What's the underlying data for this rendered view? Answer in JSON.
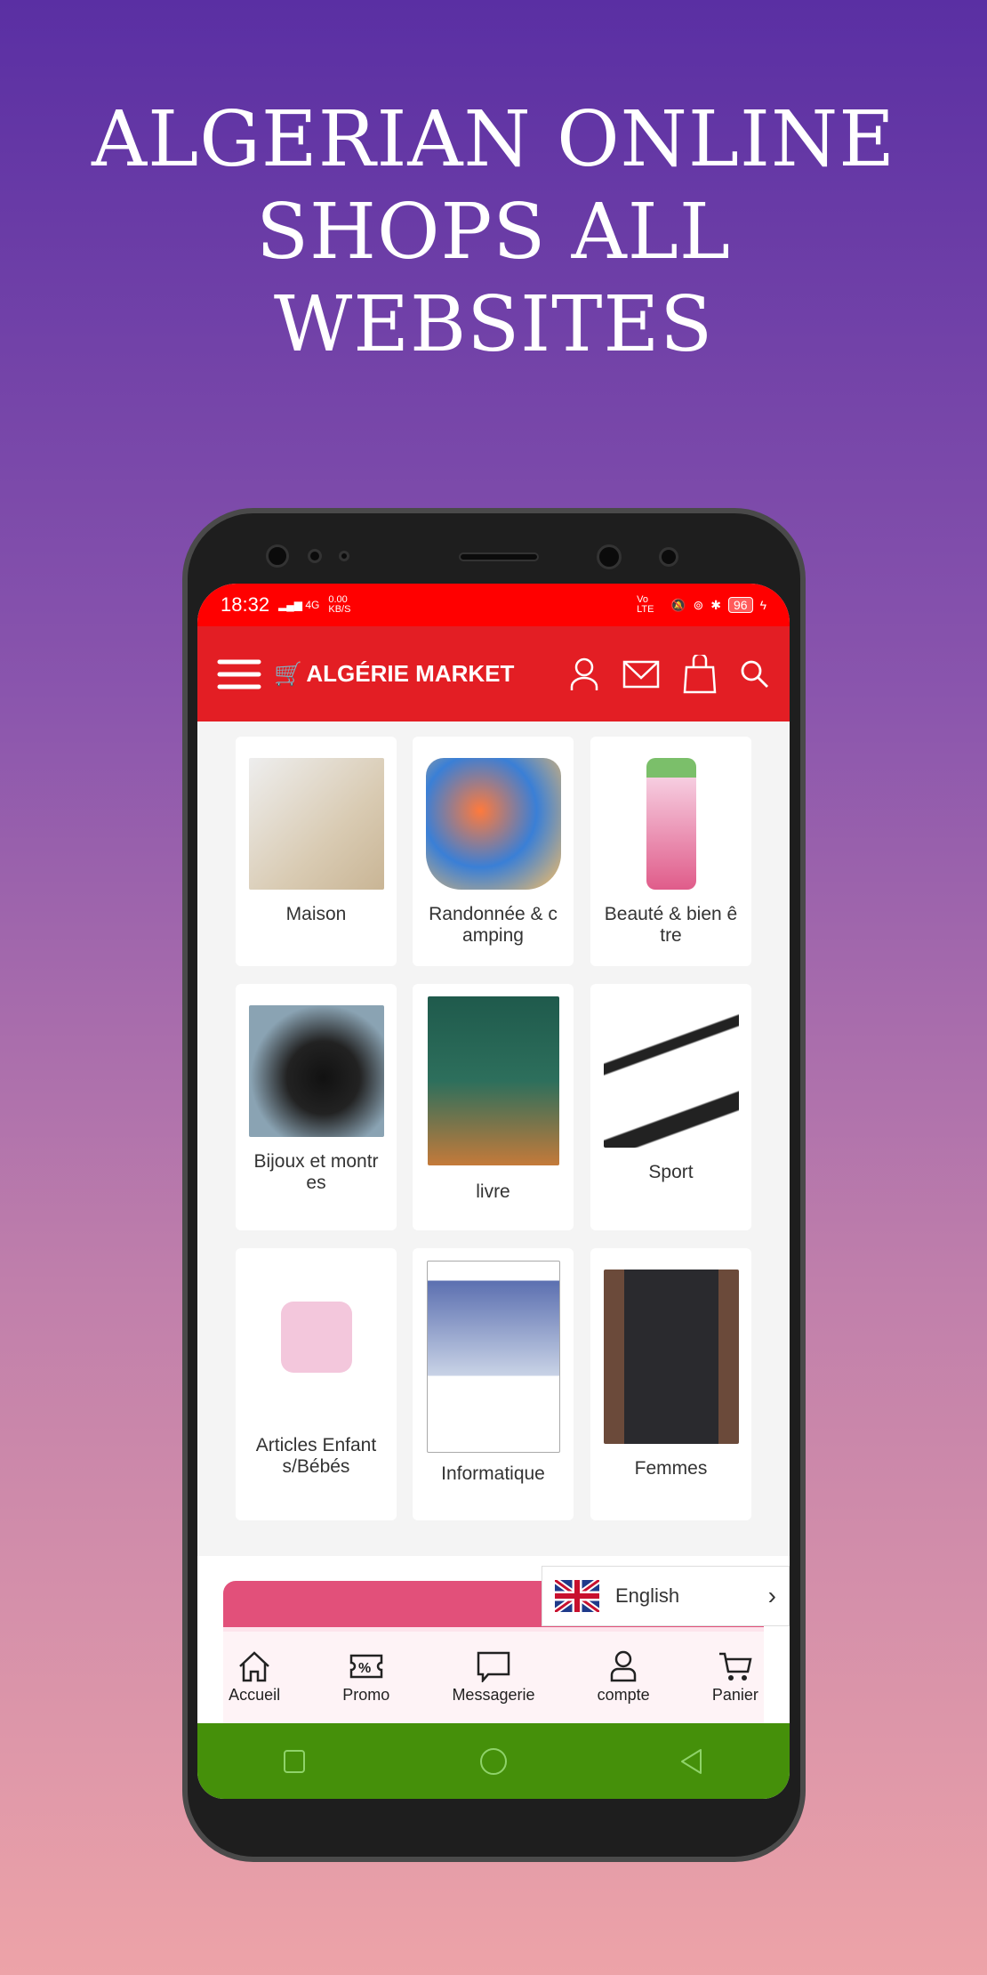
{
  "promo": {
    "headline_lines": [
      "ALGERIAN ONLINE",
      "SHOPS ALL",
      "WEBSITES"
    ]
  },
  "status_bar": {
    "time": "18:32",
    "network": "4G",
    "speed": "0.00",
    "speed_unit": "KB/S",
    "volte": "Vo LTE",
    "battery": "96"
  },
  "app_bar": {
    "brand": "ALGÉRIE MARKET",
    "icons": [
      "menu-icon",
      "user-icon",
      "mail-icon",
      "shopping-bag-icon",
      "search-icon"
    ]
  },
  "categories": [
    {
      "label": "Maison",
      "color": "#d9cbb3"
    },
    {
      "label": "Randonnée & c amping",
      "color": "#3a7fd6"
    },
    {
      "label": "Beauté & bien ê tre",
      "color": "#e05c8a"
    },
    {
      "label": "Bijoux et montr es",
      "color": "#3b4a55"
    },
    {
      "label": "livre",
      "color": "#2d6f5c"
    },
    {
      "label": "Sport",
      "color": "#e8e8e8"
    },
    {
      "label": "Articles Enfant s/Bébés",
      "color": "#f3c7dc"
    },
    {
      "label": "Informatique",
      "color": "#c9d3e6"
    },
    {
      "label": "Femmes",
      "color": "#2a2a2e"
    }
  ],
  "language": {
    "label": "English"
  },
  "bottom_nav": [
    {
      "label": "Accueil",
      "icon": "home-icon"
    },
    {
      "label": "Promo",
      "icon": "ticket-percent-icon"
    },
    {
      "label": "Messagerie",
      "icon": "chat-icon"
    },
    {
      "label": "compte",
      "icon": "user-icon"
    },
    {
      "label": "Panier",
      "icon": "cart-icon"
    }
  ],
  "colors": {
    "status": "#ff0000",
    "app_bar": "#e31e24",
    "system_nav": "#45900a"
  }
}
